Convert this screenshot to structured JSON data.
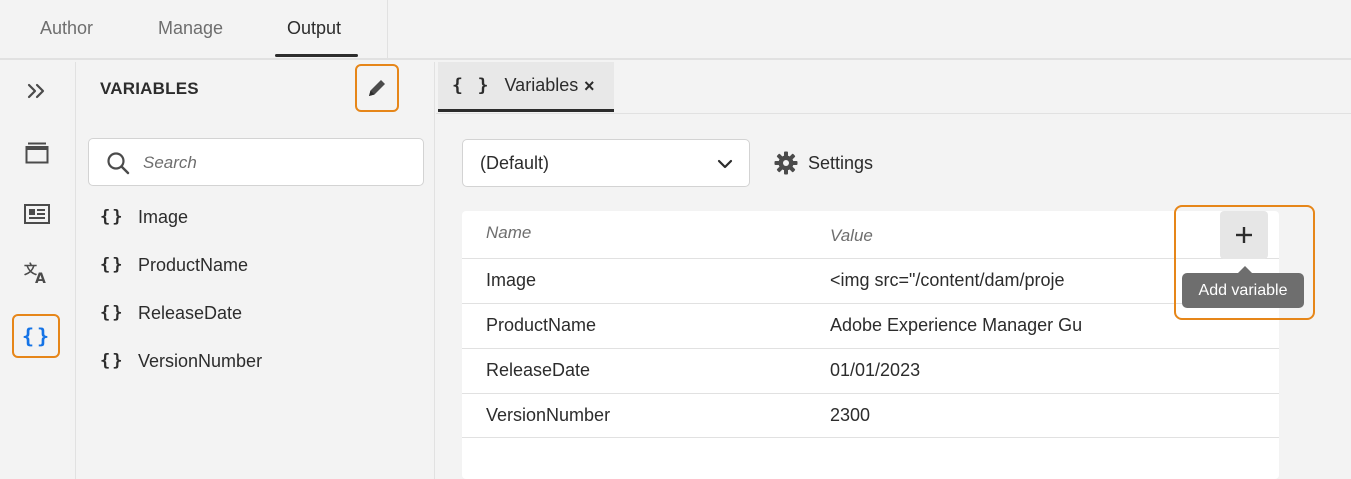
{
  "top_tabs": [
    {
      "label": "Author"
    },
    {
      "label": "Manage"
    },
    {
      "label": "Output"
    }
  ],
  "active_top_tab": "Output",
  "rail": {
    "icons": [
      "expand-icon",
      "preview-icon",
      "page-layout-icon",
      "translate-icon",
      "variables-icon"
    ],
    "active": "variables-icon"
  },
  "panel": {
    "title": "VARIABLES",
    "search_placeholder": "Search",
    "items": [
      {
        "label": "Image"
      },
      {
        "label": "ProductName"
      },
      {
        "label": "ReleaseDate"
      },
      {
        "label": "VersionNumber"
      }
    ]
  },
  "doc_tab": {
    "icon": "{ }",
    "label": "Variables",
    "close": "×"
  },
  "toolbar": {
    "profile_value": "(Default)",
    "settings_label": "Settings"
  },
  "table": {
    "col_name": "Name",
    "col_value": "Value",
    "rows": [
      {
        "name": "Image",
        "value": "<img src=\"/content/dam/proje"
      },
      {
        "name": "ProductName",
        "value": "Adobe Experience Manager Gu"
      },
      {
        "name": "ReleaseDate",
        "value": "01/01/2023"
      },
      {
        "name": "VersionNumber",
        "value": "2300"
      }
    ]
  },
  "add_button": {
    "tooltip": "Add variable"
  },
  "colors": {
    "highlight": "#e68619",
    "active_icon": "#1473e6",
    "tooltip_bg": "#6e6e6e"
  }
}
